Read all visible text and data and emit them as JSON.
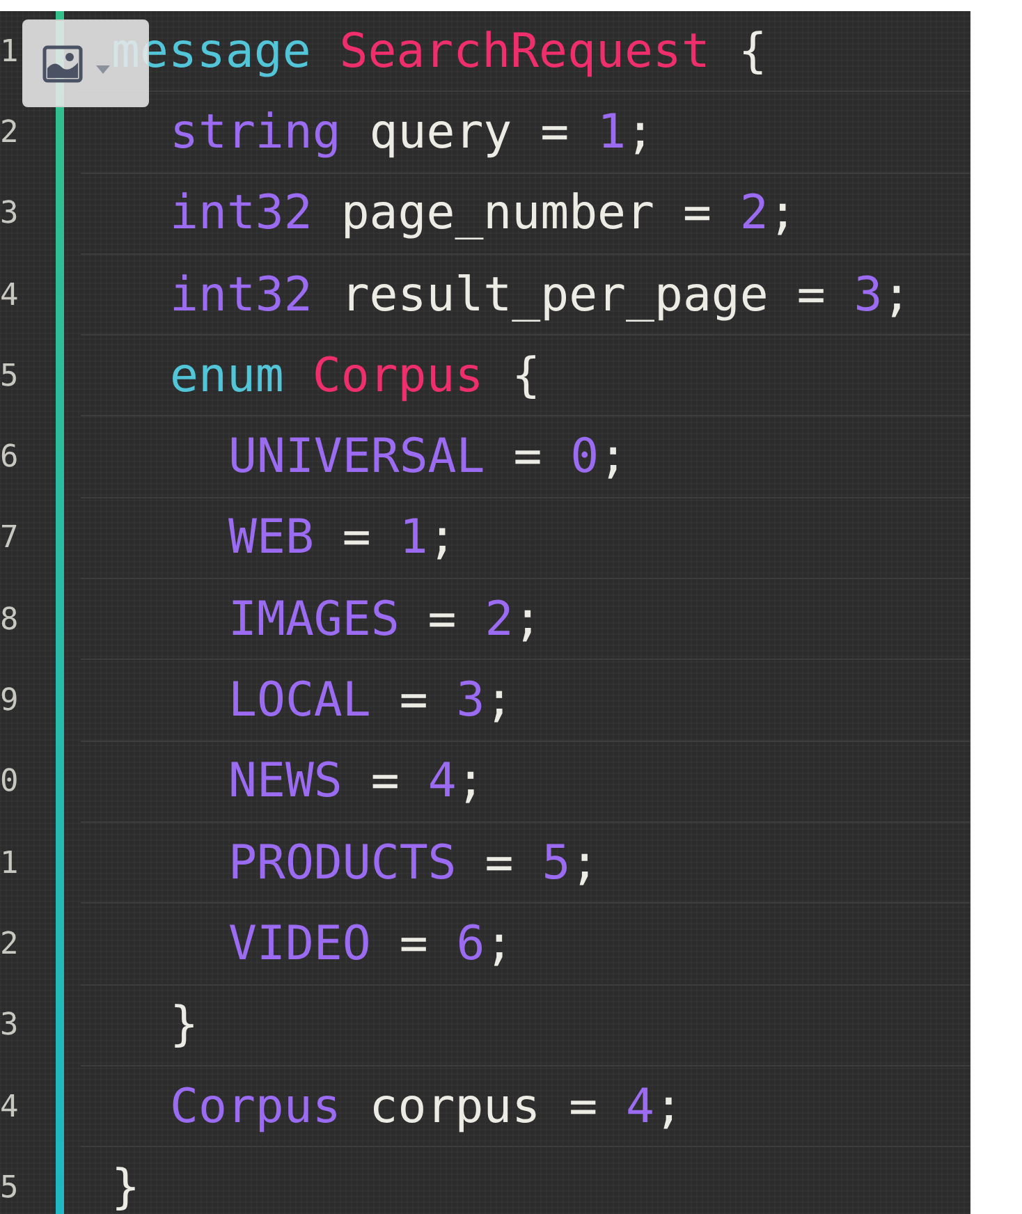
{
  "editor": {
    "lines": [
      {
        "number": "1",
        "tokens": [
          {
            "kind": "keyword",
            "text": "message"
          },
          {
            "kind": "name",
            "text": "SearchRequest",
            "gap": true
          },
          {
            "kind": "plain",
            "text": " {"
          }
        ],
        "children": [
          {
            "number": "2",
            "tokens": [
              {
                "kind": "type",
                "text": "string"
              },
              {
                "kind": "plain",
                "text": " query = "
              },
              {
                "kind": "number",
                "text": "1"
              },
              {
                "kind": "plain",
                "text": ";"
              }
            ]
          },
          {
            "number": "3",
            "tokens": [
              {
                "kind": "type",
                "text": "int32"
              },
              {
                "kind": "plain",
                "text": " page_number = "
              },
              {
                "kind": "number",
                "text": "2"
              },
              {
                "kind": "plain",
                "text": ";"
              }
            ]
          },
          {
            "number": "4",
            "tokens": [
              {
                "kind": "type",
                "text": "int32"
              },
              {
                "kind": "plain",
                "text": " result_per_page = "
              },
              {
                "kind": "number",
                "text": "3"
              },
              {
                "kind": "plain",
                "text": ";"
              }
            ]
          },
          {
            "number": "5",
            "tokens": [
              {
                "kind": "keyword",
                "text": "enum"
              },
              {
                "kind": "name",
                "text": "Corpus",
                "gap": true
              },
              {
                "kind": "plain",
                "text": " {"
              }
            ],
            "children": [
              {
                "number": "6",
                "tokens": [
                  {
                    "kind": "constant",
                    "text": "UNIVERSAL"
                  },
                  {
                    "kind": "plain",
                    "text": " = "
                  },
                  {
                    "kind": "number",
                    "text": "0"
                  },
                  {
                    "kind": "plain",
                    "text": ";"
                  }
                ]
              },
              {
                "number": "7",
                "tokens": [
                  {
                    "kind": "constant",
                    "text": "WEB"
                  },
                  {
                    "kind": "plain",
                    "text": " = "
                  },
                  {
                    "kind": "number",
                    "text": "1"
                  },
                  {
                    "kind": "plain",
                    "text": ";"
                  }
                ]
              },
              {
                "number": "8",
                "tokens": [
                  {
                    "kind": "constant",
                    "text": "IMAGES"
                  },
                  {
                    "kind": "plain",
                    "text": " = "
                  },
                  {
                    "kind": "number",
                    "text": "2"
                  },
                  {
                    "kind": "plain",
                    "text": ";"
                  }
                ]
              },
              {
                "number": "9",
                "tokens": [
                  {
                    "kind": "constant",
                    "text": "LOCAL"
                  },
                  {
                    "kind": "plain",
                    "text": " = "
                  },
                  {
                    "kind": "number",
                    "text": "3"
                  },
                  {
                    "kind": "plain",
                    "text": ";"
                  }
                ]
              },
              {
                "number": "0",
                "tokens": [
                  {
                    "kind": "constant",
                    "text": "NEWS"
                  },
                  {
                    "kind": "plain",
                    "text": " = "
                  },
                  {
                    "kind": "number",
                    "text": "4"
                  },
                  {
                    "kind": "plain",
                    "text": ";"
                  }
                ]
              },
              {
                "number": "1",
                "tokens": [
                  {
                    "kind": "constant",
                    "text": "PRODUCTS"
                  },
                  {
                    "kind": "plain",
                    "text": " = "
                  },
                  {
                    "kind": "number",
                    "text": "5"
                  },
                  {
                    "kind": "plain",
                    "text": ";"
                  }
                ]
              },
              {
                "number": "2",
                "tokens": [
                  {
                    "kind": "constant",
                    "text": "VIDEO"
                  },
                  {
                    "kind": "plain",
                    "text": " = "
                  },
                  {
                    "kind": "number",
                    "text": "6"
                  },
                  {
                    "kind": "plain",
                    "text": ";"
                  }
                ]
              }
            ]
          },
          {
            "number": "3",
            "tokens": [
              {
                "kind": "plain",
                "text": "}"
              }
            ]
          },
          {
            "number": "4",
            "tokens": [
              {
                "kind": "type",
                "text": "Corpus"
              },
              {
                "kind": "plain",
                "text": " corpus = "
              },
              {
                "kind": "number",
                "text": "4"
              },
              {
                "kind": "plain",
                "text": ";"
              }
            ]
          }
        ]
      },
      {
        "number": "5",
        "tokens": [
          {
            "kind": "plain",
            "text": "}"
          }
        ]
      }
    ]
  }
}
